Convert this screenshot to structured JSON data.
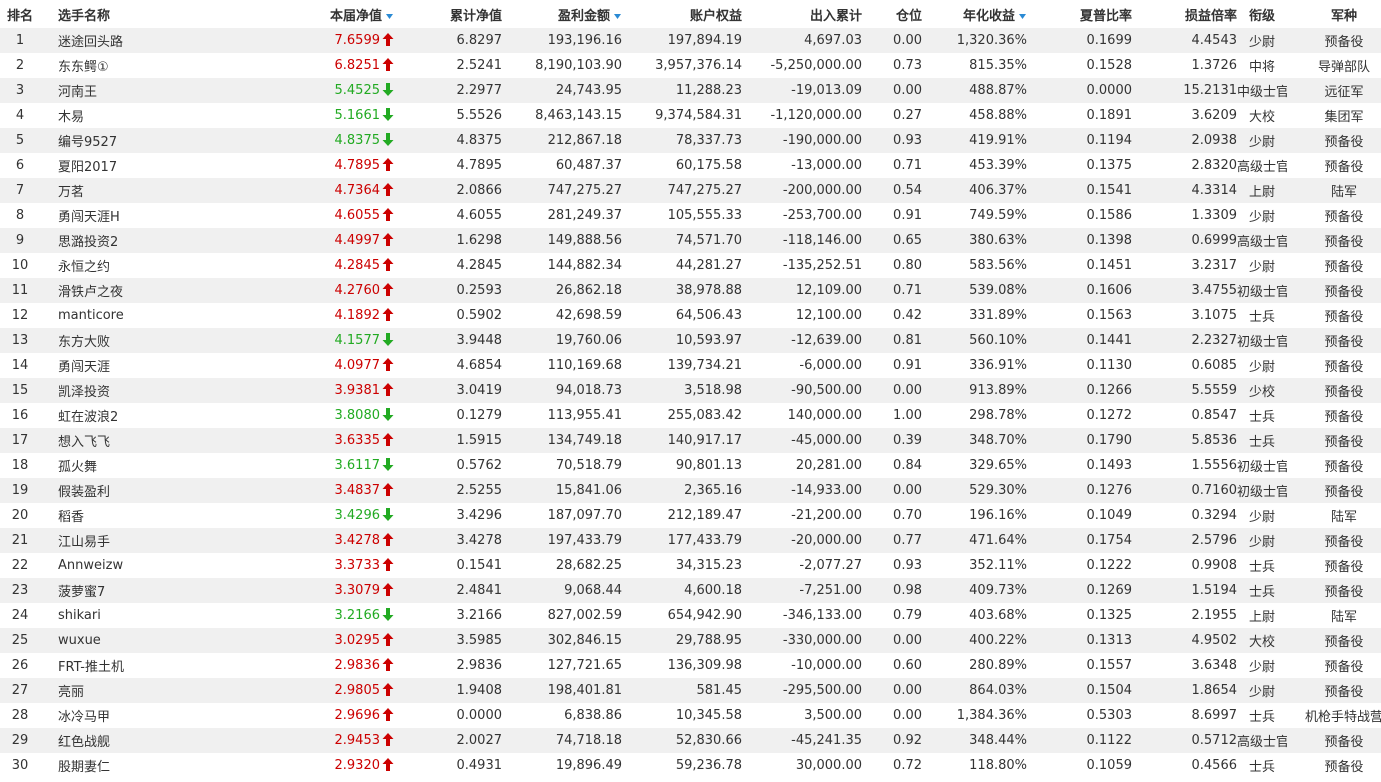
{
  "colors": {
    "up": "#cc0000",
    "down": "#22aa22",
    "sort_indicator": "#2a8ad4",
    "row_stripe": "#f0f0f0"
  },
  "headers": [
    "排名",
    "选手名称",
    "本届净值",
    "累计净值",
    "盈利金额",
    "账户权益",
    "出入累计",
    "仓位",
    "年化收益",
    "夏普比率",
    "损益倍率",
    "衔级",
    "军种"
  ],
  "sortable_columns": [
    "本届净值",
    "盈利金额",
    "年化收益"
  ],
  "rows": [
    {
      "rank": "1",
      "name": "迷途回头路",
      "nav": "7.6599",
      "trend": "up",
      "cum_nav": "6.8297",
      "profit": "193,196.16",
      "equity": "197,894.19",
      "flow": "4,697.03",
      "position": "0.00",
      "annual": "1,320.36%",
      "sharpe": "0.1699",
      "pl_ratio": "4.4543",
      "rank_title": "少尉",
      "branch": "预备役"
    },
    {
      "rank": "2",
      "name": "东东鳄①",
      "nav": "6.8251",
      "trend": "up",
      "cum_nav": "2.5241",
      "profit": "8,190,103.90",
      "equity": "3,957,376.14",
      "flow": "-5,250,000.00",
      "position": "0.73",
      "annual": "815.35%",
      "sharpe": "0.1528",
      "pl_ratio": "1.3726",
      "rank_title": "中将",
      "branch": "导弹部队"
    },
    {
      "rank": "3",
      "name": "河南王",
      "nav": "5.4525",
      "trend": "down",
      "cum_nav": "2.2977",
      "profit": "24,743.95",
      "equity": "11,288.23",
      "flow": "-19,013.09",
      "position": "0.00",
      "annual": "488.87%",
      "sharpe": "0.0000",
      "pl_ratio": "15.2131",
      "rank_title": "中级士官",
      "branch": "远征军"
    },
    {
      "rank": "4",
      "name": "木易",
      "nav": "5.1661",
      "trend": "down",
      "cum_nav": "5.5526",
      "profit": "8,463,143.15",
      "equity": "9,374,584.31",
      "flow": "-1,120,000.00",
      "position": "0.27",
      "annual": "458.88%",
      "sharpe": "0.1891",
      "pl_ratio": "3.6209",
      "rank_title": "大校",
      "branch": "集团军"
    },
    {
      "rank": "5",
      "name": "编号9527",
      "nav": "4.8375",
      "trend": "down",
      "cum_nav": "4.8375",
      "profit": "212,867.18",
      "equity": "78,337.73",
      "flow": "-190,000.00",
      "position": "0.93",
      "annual": "419.91%",
      "sharpe": "0.1194",
      "pl_ratio": "2.0938",
      "rank_title": "少尉",
      "branch": "预备役"
    },
    {
      "rank": "6",
      "name": "夏阳2017",
      "nav": "4.7895",
      "trend": "up",
      "cum_nav": "4.7895",
      "profit": "60,487.37",
      "equity": "60,175.58",
      "flow": "-13,000.00",
      "position": "0.71",
      "annual": "453.39%",
      "sharpe": "0.1375",
      "pl_ratio": "2.8320",
      "rank_title": "高级士官",
      "branch": "预备役"
    },
    {
      "rank": "7",
      "name": "万茗",
      "nav": "4.7364",
      "trend": "up",
      "cum_nav": "2.0866",
      "profit": "747,275.27",
      "equity": "747,275.27",
      "flow": "-200,000.00",
      "position": "0.54",
      "annual": "406.37%",
      "sharpe": "0.1541",
      "pl_ratio": "4.3314",
      "rank_title": "上尉",
      "branch": "陆军"
    },
    {
      "rank": "8",
      "name": "勇闯天涯H",
      "nav": "4.6055",
      "trend": "up",
      "cum_nav": "4.6055",
      "profit": "281,249.37",
      "equity": "105,555.33",
      "flow": "-253,700.00",
      "position": "0.91",
      "annual": "749.59%",
      "sharpe": "0.1586",
      "pl_ratio": "1.3309",
      "rank_title": "少尉",
      "branch": "预备役"
    },
    {
      "rank": "9",
      "name": "思潞投资2",
      "nav": "4.4997",
      "trend": "up",
      "cum_nav": "1.6298",
      "profit": "149,888.56",
      "equity": "74,571.70",
      "flow": "-118,146.00",
      "position": "0.65",
      "annual": "380.63%",
      "sharpe": "0.1398",
      "pl_ratio": "0.6999",
      "rank_title": "高级士官",
      "branch": "预备役"
    },
    {
      "rank": "10",
      "name": "永恒之约",
      "nav": "4.2845",
      "trend": "up",
      "cum_nav": "4.2845",
      "profit": "144,882.34",
      "equity": "44,281.27",
      "flow": "-135,252.51",
      "position": "0.80",
      "annual": "583.56%",
      "sharpe": "0.1451",
      "pl_ratio": "3.2317",
      "rank_title": "少尉",
      "branch": "预备役"
    },
    {
      "rank": "11",
      "name": "滑铁卢之夜",
      "nav": "4.2760",
      "trend": "up",
      "cum_nav": "0.2593",
      "profit": "26,862.18",
      "equity": "38,978.88",
      "flow": "12,109.00",
      "position": "0.71",
      "annual": "539.08%",
      "sharpe": "0.1606",
      "pl_ratio": "3.4755",
      "rank_title": "初级士官",
      "branch": "预备役"
    },
    {
      "rank": "12",
      "name": "manticore",
      "nav": "4.1892",
      "trend": "up",
      "cum_nav": "0.5902",
      "profit": "42,698.59",
      "equity": "64,506.43",
      "flow": "12,100.00",
      "position": "0.42",
      "annual": "331.89%",
      "sharpe": "0.1563",
      "pl_ratio": "3.1075",
      "rank_title": "士兵",
      "branch": "预备役"
    },
    {
      "rank": "13",
      "name": "东方大败",
      "nav": "4.1577",
      "trend": "down",
      "cum_nav": "3.9448",
      "profit": "19,760.06",
      "equity": "10,593.97",
      "flow": "-12,639.00",
      "position": "0.81",
      "annual": "560.10%",
      "sharpe": "0.1441",
      "pl_ratio": "2.2327",
      "rank_title": "初级士官",
      "branch": "预备役"
    },
    {
      "rank": "14",
      "name": "勇闯天涯",
      "nav": "4.0977",
      "trend": "up",
      "cum_nav": "4.6854",
      "profit": "110,169.68",
      "equity": "139,734.21",
      "flow": "-6,000.00",
      "position": "0.91",
      "annual": "336.91%",
      "sharpe": "0.1130",
      "pl_ratio": "0.6085",
      "rank_title": "少尉",
      "branch": "预备役"
    },
    {
      "rank": "15",
      "name": "凯泽投资",
      "nav": "3.9381",
      "trend": "up",
      "cum_nav": "3.0419",
      "profit": "94,018.73",
      "equity": "3,518.98",
      "flow": "-90,500.00",
      "position": "0.00",
      "annual": "913.89%",
      "sharpe": "0.1266",
      "pl_ratio": "5.5559",
      "rank_title": "少校",
      "branch": "预备役"
    },
    {
      "rank": "16",
      "name": "虹在波浪2",
      "nav": "3.8080",
      "trend": "down",
      "cum_nav": "0.1279",
      "profit": "113,955.41",
      "equity": "255,083.42",
      "flow": "140,000.00",
      "position": "1.00",
      "annual": "298.78%",
      "sharpe": "0.1272",
      "pl_ratio": "0.8547",
      "rank_title": "士兵",
      "branch": "预备役"
    },
    {
      "rank": "17",
      "name": "想入飞飞",
      "nav": "3.6335",
      "trend": "up",
      "cum_nav": "1.5915",
      "profit": "134,749.18",
      "equity": "140,917.17",
      "flow": "-45,000.00",
      "position": "0.39",
      "annual": "348.70%",
      "sharpe": "0.1790",
      "pl_ratio": "5.8536",
      "rank_title": "士兵",
      "branch": "预备役"
    },
    {
      "rank": "18",
      "name": "孤火舞",
      "nav": "3.6117",
      "trend": "down",
      "cum_nav": "0.5762",
      "profit": "70,518.79",
      "equity": "90,801.13",
      "flow": "20,281.00",
      "position": "0.84",
      "annual": "329.65%",
      "sharpe": "0.1493",
      "pl_ratio": "1.5556",
      "rank_title": "初级士官",
      "branch": "预备役"
    },
    {
      "rank": "19",
      "name": "假装盈利",
      "nav": "3.4837",
      "trend": "up",
      "cum_nav": "2.5255",
      "profit": "15,841.06",
      "equity": "2,365.16",
      "flow": "-14,933.00",
      "position": "0.00",
      "annual": "529.30%",
      "sharpe": "0.1276",
      "pl_ratio": "0.7160",
      "rank_title": "初级士官",
      "branch": "预备役"
    },
    {
      "rank": "20",
      "name": "稻香",
      "nav": "3.4296",
      "trend": "down",
      "cum_nav": "3.4296",
      "profit": "187,097.70",
      "equity": "212,189.47",
      "flow": "-21,200.00",
      "position": "0.70",
      "annual": "196.16%",
      "sharpe": "0.1049",
      "pl_ratio": "0.3294",
      "rank_title": "少尉",
      "branch": "陆军"
    },
    {
      "rank": "21",
      "name": "江山易手",
      "nav": "3.4278",
      "trend": "up",
      "cum_nav": "3.4278",
      "profit": "197,433.79",
      "equity": "177,433.79",
      "flow": "-20,000.00",
      "position": "0.77",
      "annual": "471.64%",
      "sharpe": "0.1754",
      "pl_ratio": "2.5796",
      "rank_title": "少尉",
      "branch": "预备役"
    },
    {
      "rank": "22",
      "name": "Annweizw",
      "nav": "3.3733",
      "trend": "up",
      "cum_nav": "0.1541",
      "profit": "28,682.25",
      "equity": "34,315.23",
      "flow": "-2,077.27",
      "position": "0.93",
      "annual": "352.11%",
      "sharpe": "0.1222",
      "pl_ratio": "0.9908",
      "rank_title": "士兵",
      "branch": "预备役"
    },
    {
      "rank": "23",
      "name": "菠萝蜜7",
      "nav": "3.3079",
      "trend": "up",
      "cum_nav": "2.4841",
      "profit": "9,068.44",
      "equity": "4,600.18",
      "flow": "-7,251.00",
      "position": "0.98",
      "annual": "409.73%",
      "sharpe": "0.1269",
      "pl_ratio": "1.5194",
      "rank_title": "士兵",
      "branch": "预备役"
    },
    {
      "rank": "24",
      "name": "shikari",
      "nav": "3.2166",
      "trend": "down",
      "cum_nav": "3.2166",
      "profit": "827,002.59",
      "equity": "654,942.90",
      "flow": "-346,133.00",
      "position": "0.79",
      "annual": "403.68%",
      "sharpe": "0.1325",
      "pl_ratio": "2.1955",
      "rank_title": "上尉",
      "branch": "陆军"
    },
    {
      "rank": "25",
      "name": "wuxue",
      "nav": "3.0295",
      "trend": "up",
      "cum_nav": "3.5985",
      "profit": "302,846.15",
      "equity": "29,788.95",
      "flow": "-330,000.00",
      "position": "0.00",
      "annual": "400.22%",
      "sharpe": "0.1313",
      "pl_ratio": "4.9502",
      "rank_title": "大校",
      "branch": "预备役"
    },
    {
      "rank": "26",
      "name": "FRT-推土机",
      "nav": "2.9836",
      "trend": "up",
      "cum_nav": "2.9836",
      "profit": "127,721.65",
      "equity": "136,309.98",
      "flow": "-10,000.00",
      "position": "0.60",
      "annual": "280.89%",
      "sharpe": "0.1557",
      "pl_ratio": "3.6348",
      "rank_title": "少尉",
      "branch": "预备役"
    },
    {
      "rank": "27",
      "name": "亮丽",
      "nav": "2.9805",
      "trend": "up",
      "cum_nav": "1.9408",
      "profit": "198,401.81",
      "equity": "581.45",
      "flow": "-295,500.00",
      "position": "0.00",
      "annual": "864.03%",
      "sharpe": "0.1504",
      "pl_ratio": "1.8654",
      "rank_title": "少尉",
      "branch": "预备役"
    },
    {
      "rank": "28",
      "name": "冰冷马甲",
      "nav": "2.9696",
      "trend": "up",
      "cum_nav": "0.0000",
      "profit": "6,838.86",
      "equity": "10,345.58",
      "flow": "3,500.00",
      "position": "0.00",
      "annual": "1,384.36%",
      "sharpe": "0.5303",
      "pl_ratio": "8.6997",
      "rank_title": "士兵",
      "branch": "机枪手特战营"
    },
    {
      "rank": "29",
      "name": "红色战舰",
      "nav": "2.9453",
      "trend": "up",
      "cum_nav": "2.0027",
      "profit": "74,718.18",
      "equity": "52,830.66",
      "flow": "-45,241.35",
      "position": "0.92",
      "annual": "348.44%",
      "sharpe": "0.1122",
      "pl_ratio": "0.5712",
      "rank_title": "高级士官",
      "branch": "预备役"
    },
    {
      "rank": "30",
      "name": "股期妻仁",
      "nav": "2.9320",
      "trend": "up",
      "cum_nav": "0.4931",
      "profit": "19,896.49",
      "equity": "59,236.78",
      "flow": "30,000.00",
      "position": "0.72",
      "annual": "118.80%",
      "sharpe": "0.1059",
      "pl_ratio": "0.4566",
      "rank_title": "士兵",
      "branch": "预备役"
    }
  ]
}
